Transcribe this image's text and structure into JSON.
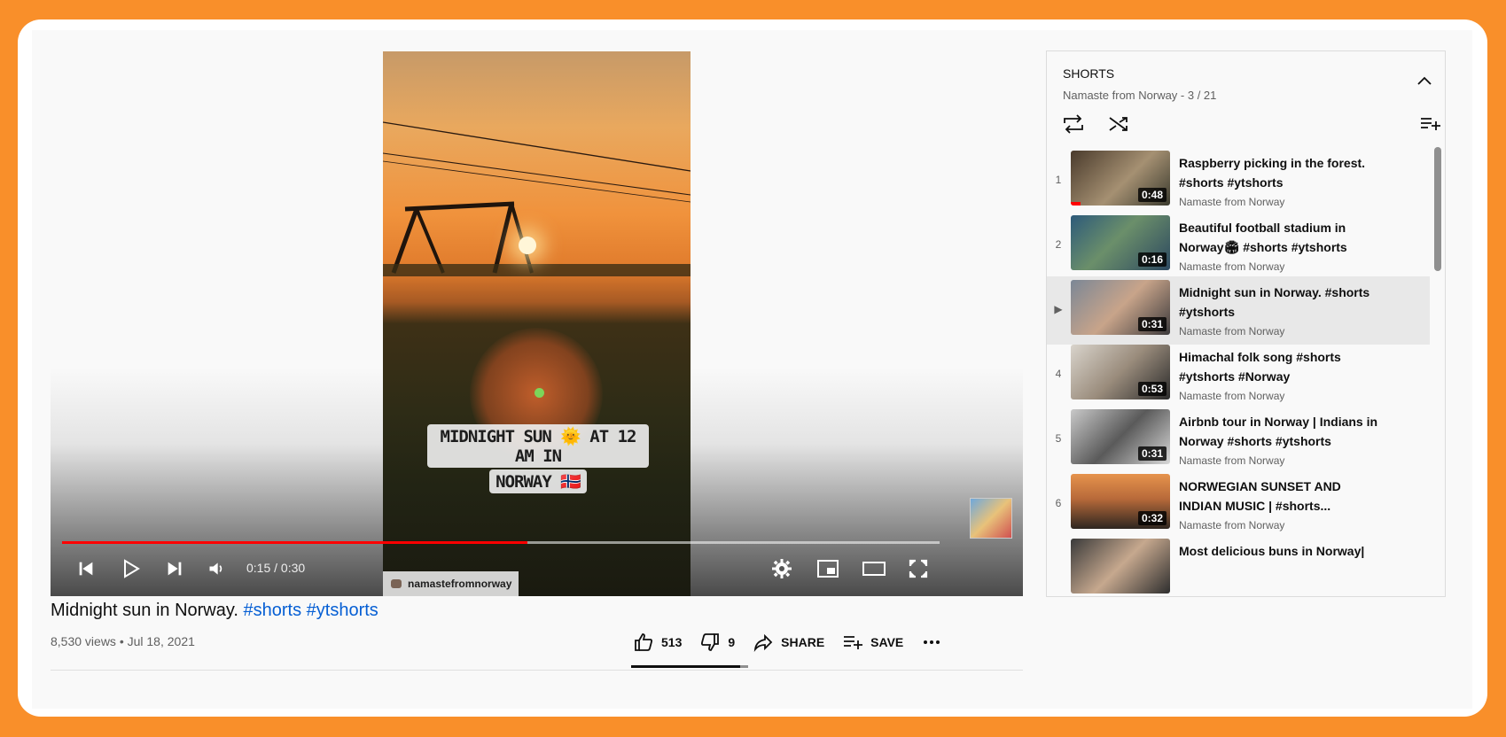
{
  "video": {
    "caption_line1": "MIDNIGHT SUN 🌞 AT 12 AM IN",
    "caption_line2": "NORWAY 🇳🇴",
    "instagram_handle": "namastefromnorway",
    "time_display": "0:15 / 0:30",
    "progress_fraction": 0.53,
    "title_plain": "Midnight sun in Norway.",
    "title_tags": "#shorts #ytshorts",
    "meta": "8,530 views • Jul 18, 2021"
  },
  "actions": {
    "likes": "513",
    "dislikes": "9",
    "share_label": "SHARE",
    "save_label": "SAVE",
    "like_ratio": 0.93
  },
  "playlist": {
    "title": "SHORTS",
    "subtitle": "Namaste from Norway - 3 / 21",
    "items": [
      {
        "index": "1",
        "title": "Raspberry picking in the forest. #shorts #ytshorts",
        "channel": "Namaste from Norway",
        "duration": "0:48",
        "watched_fraction": 0.1
      },
      {
        "index": "2",
        "title": "Beautiful football stadium in Norway🏟 #shorts #ytshorts",
        "channel": "Namaste from Norway",
        "duration": "0:16"
      },
      {
        "index": "▶",
        "title": "Midnight sun in Norway. #shorts #ytshorts",
        "channel": "Namaste from Norway",
        "duration": "0:31"
      },
      {
        "index": "4",
        "title": "Himachal folk song #shorts #ytshorts #Norway",
        "channel": "Namaste from Norway",
        "duration": "0:53"
      },
      {
        "index": "5",
        "title": "Airbnb tour in Norway | Indians in Norway #shorts #ytshorts",
        "channel": "Namaste from Norway",
        "duration": "0:31"
      },
      {
        "index": "6",
        "title": "NORWEGIAN SUNSET AND INDIAN MUSIC | #shorts...",
        "channel": "Namaste from Norway",
        "duration": "0:32"
      },
      {
        "index": "",
        "title": "Most delicious buns in Norway|",
        "channel": "",
        "duration": ""
      }
    ]
  },
  "colors": {
    "accent_red": "#ff0000",
    "link_blue": "#065fd4",
    "frame_border": "#f98f2a"
  }
}
